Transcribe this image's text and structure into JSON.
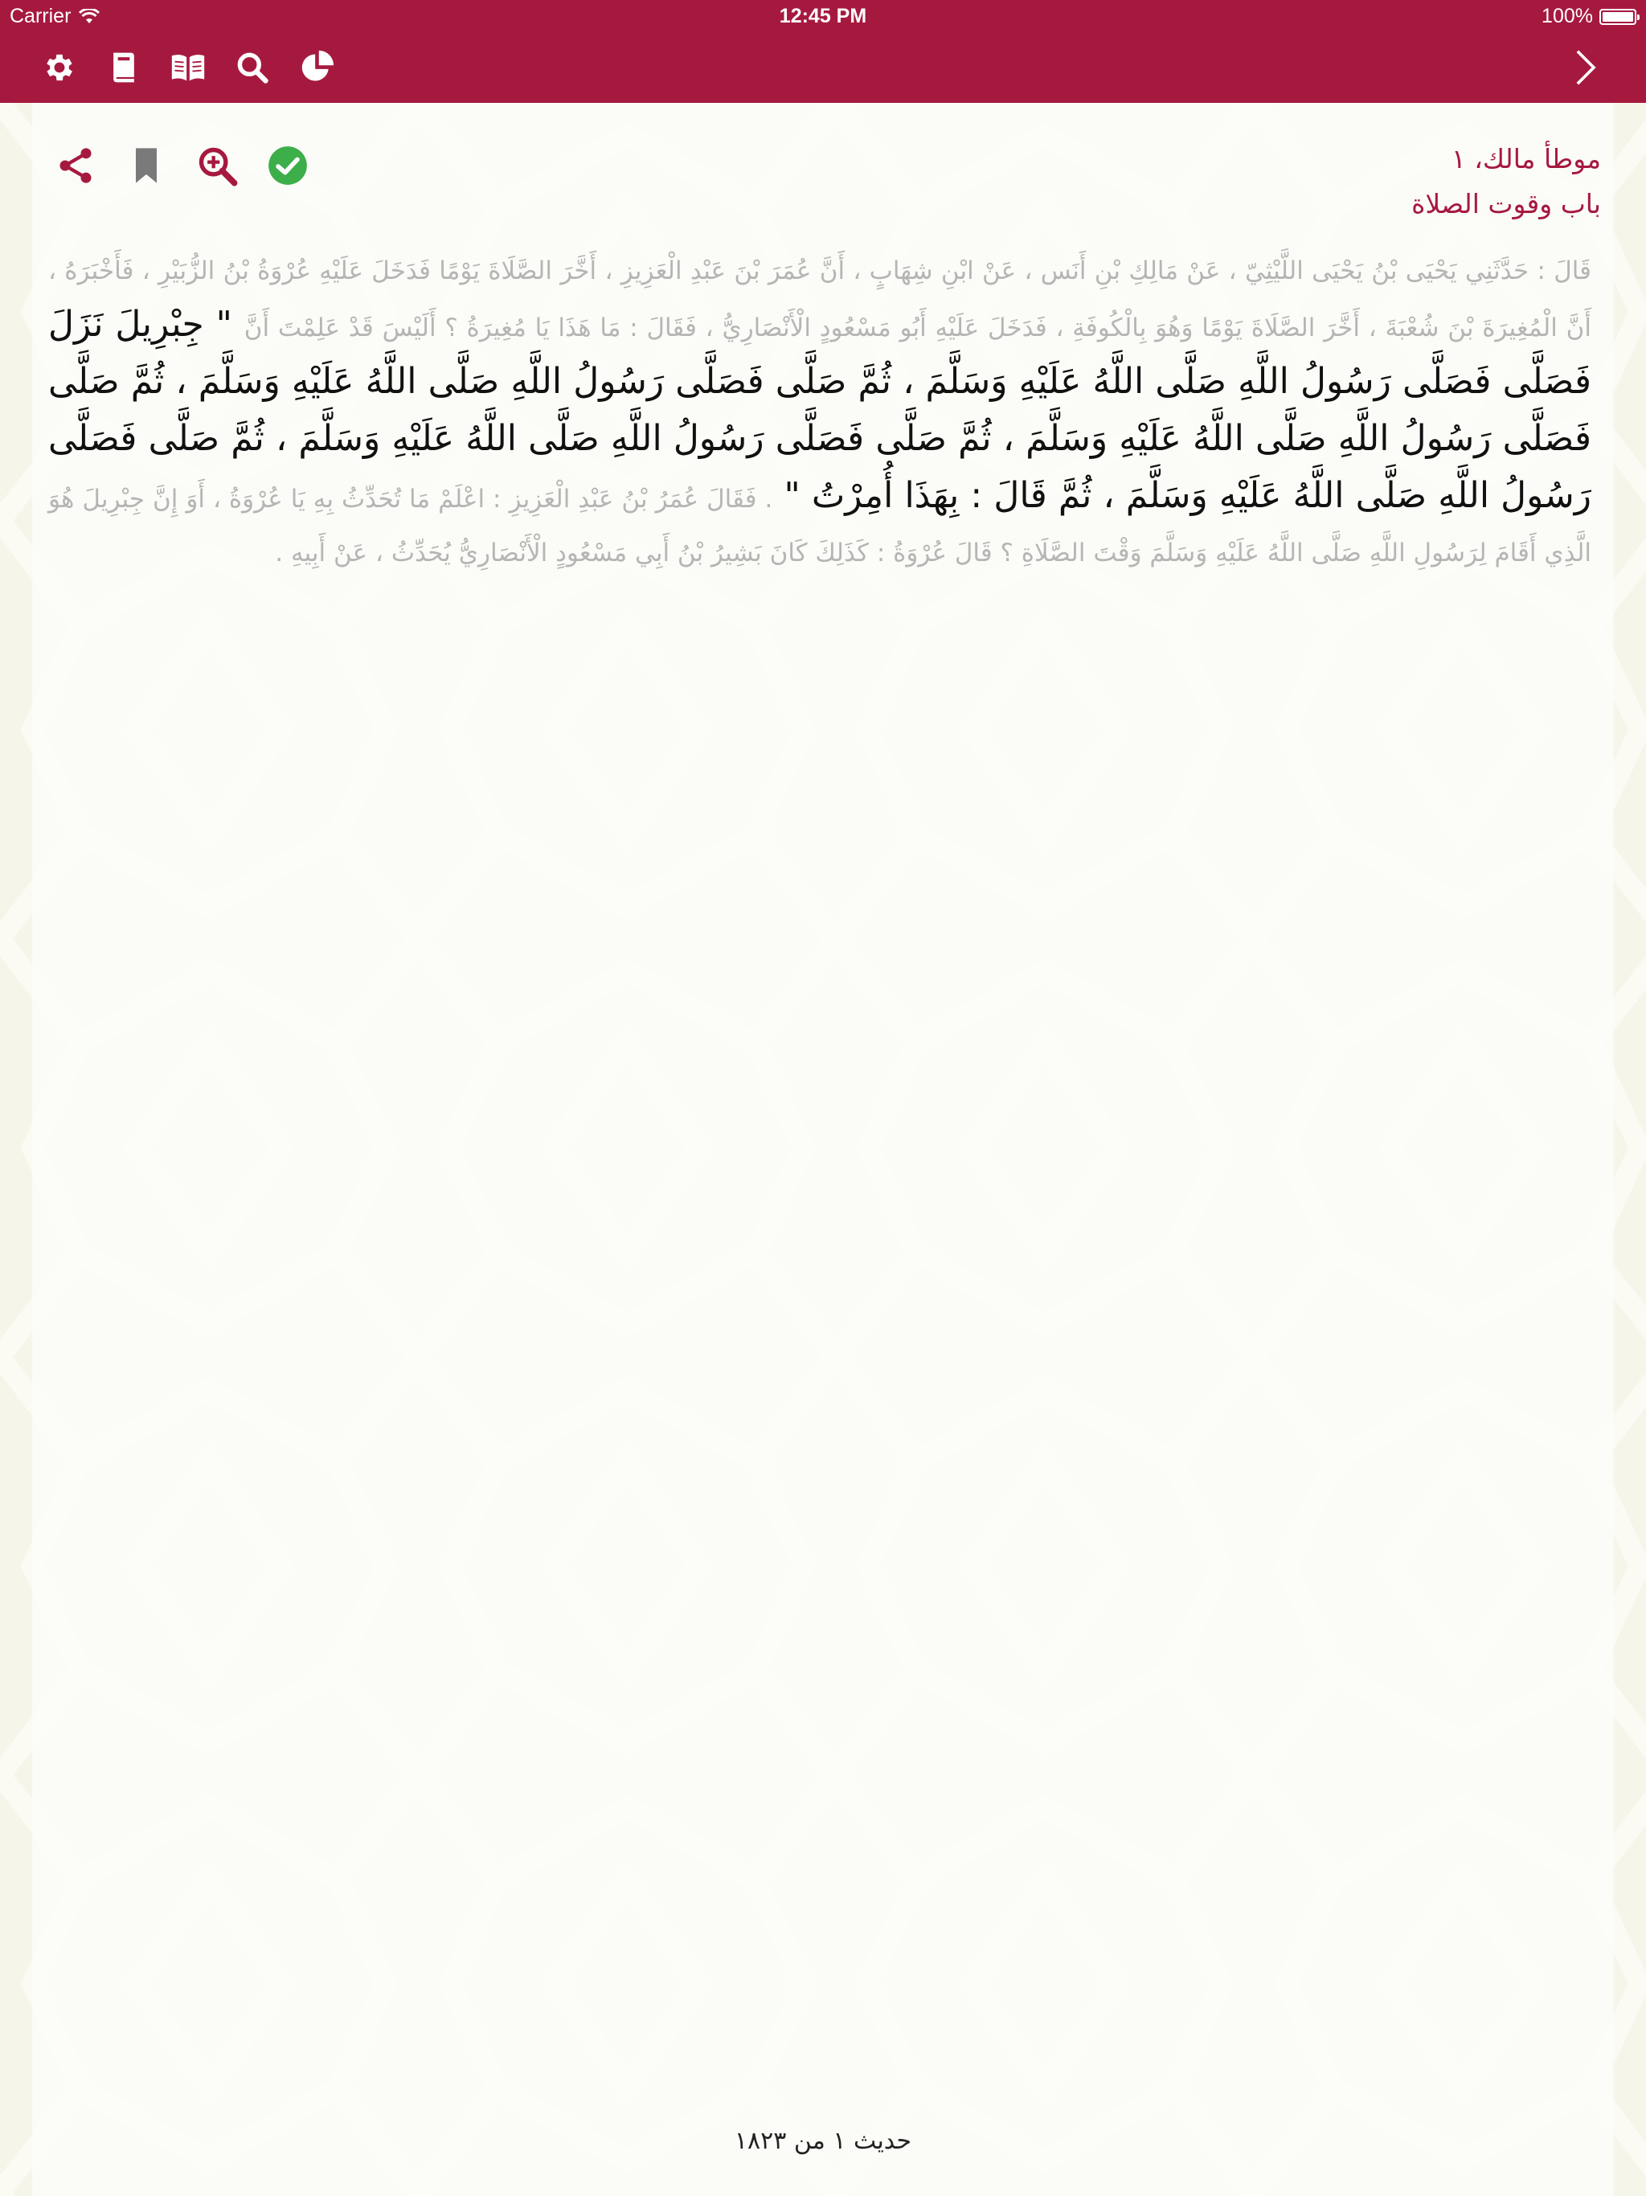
{
  "status_bar": {
    "carrier": "Carrier",
    "time": "12:45 PM",
    "battery": "100%",
    "battery_level": 1.0
  },
  "nav_bar": {
    "background": "#a6193f",
    "icons": [
      "gear-icon",
      "book-icon",
      "open-book-icon",
      "search-icon",
      "pie-chart-icon",
      "chevron-right-icon"
    ]
  },
  "actions": {
    "icons": [
      "share-icon",
      "bookmark-icon",
      "zoom-in-icon",
      "check-circle-icon"
    ],
    "check_color": "#3cae4a",
    "gray": "#7a7a7a",
    "accent": "#a6193f"
  },
  "header": {
    "book": "موطأ مالك، ١",
    "chapter": "باب وقوت الصلاة"
  },
  "hadith": {
    "isnad": "قَالَ : حَدَّثَنِي يَحْيَى بْنُ يَحْيَى اللَّيْثِيّ ، عَنْ مَالِكِ بْنِ أَنَس ، عَنْ ابْنِ شِهَابٍ ، أَنَّ عُمَرَ بْنَ عَبْدِ الْعَزِيزِ ، أَخَّرَ الصَّلَاةَ يَوْمًا فَدَخَلَ عَلَيْهِ عُرْوَةُ بْنُ الزُّبَيْرِ ، فَأَخْبَرَهُ ، أَنَّ الْمُغِيرَةَ بْنَ شُعْبَةَ ، أَخَّرَ الصَّلَاةَ يَوْمًا وَهُوَ بِالْكُوفَةِ ، فَدَخَلَ عَلَيْهِ أَبُو مَسْعُودٍ الْأَنْصَارِيُّ ، فَقَالَ : مَا هَذَا يَا مُغِيرَةُ ؟ أَلَيْسَ قَدْ عَلِمْتَ أَنَّ",
    "matn": " \" جِبْرِيلَ نَزَلَ فَصَلَّى فَصَلَّى رَسُولُ اللَّهِ صَلَّى اللَّهُ عَلَيْهِ وَسَلَّمَ ، ثُمَّ صَلَّى فَصَلَّى رَسُولُ اللَّهِ صَلَّى اللَّهُ عَلَيْهِ وَسَلَّمَ ، ثُمَّ صَلَّى فَصَلَّى رَسُولُ اللَّهِ صَلَّى اللَّهُ عَلَيْهِ وَسَلَّمَ ، ثُمَّ صَلَّى فَصَلَّى رَسُولُ اللَّهِ صَلَّى اللَّهُ عَلَيْهِ وَسَلَّمَ ، ثُمَّ صَلَّى فَصَلَّى رَسُولُ اللَّهِ صَلَّى اللَّهُ عَلَيْهِ وَسَلَّمَ ، ثُمَّ قَالَ : بِهَذَا أُمِرْتُ \" ",
    "tail": ". فَقَالَ عُمَرُ بْنُ عَبْدِ الْعَزِيزِ : اعْلَمْ مَا تُحَدِّثُ بِهِ يَا عُرْوَةُ ، أَوَ إِنَّ جِبْرِيلَ هُوَ الَّذِي أَقَامَ لِرَسُولِ اللَّهِ صَلَّى اللَّهُ عَلَيْهِ وَسَلَّمَ وَقْتَ الصَّلَاةِ ؟ قَالَ عُرْوَةُ : كَذَلِكَ كَانَ بَشِيرُ بْنُ أَبِي مَسْعُودٍ الْأَنْصَارِيُّ يُحَدِّثُ ، عَنْ أَبِيهِ ."
  },
  "footer": {
    "counter": "حديث ١ من ١٨٢٣"
  }
}
